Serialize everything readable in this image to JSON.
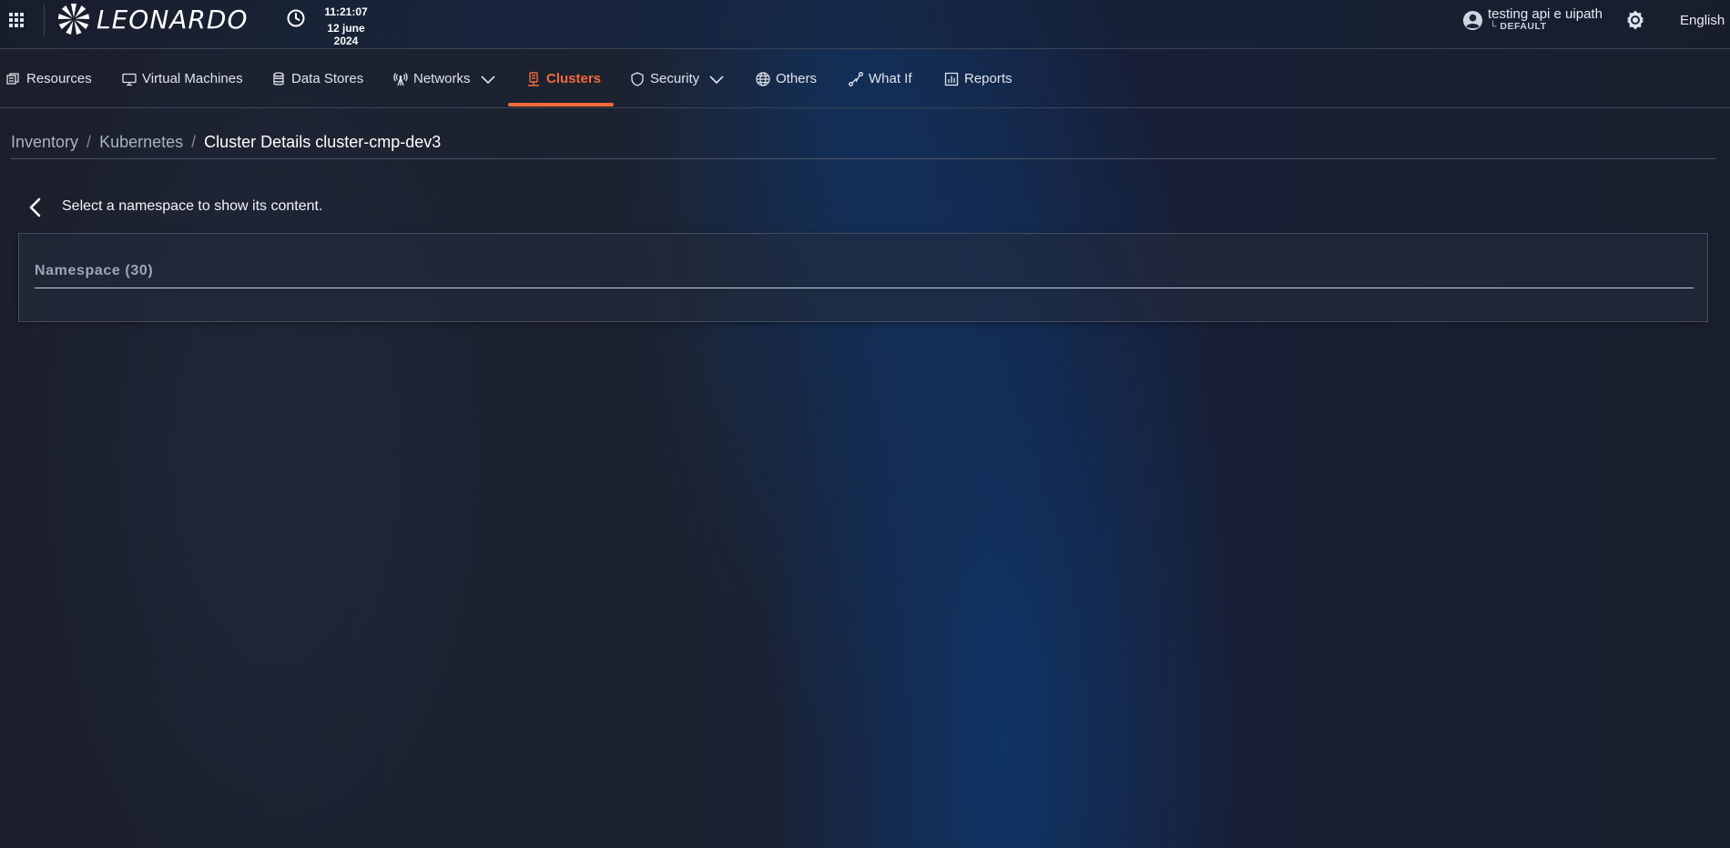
{
  "header": {
    "apps_icon": "grid-apps-icon",
    "brand": "LEONARDO",
    "clock": {
      "icon": "clock-icon",
      "time": "11:21:07",
      "date": "12 june 2024"
    },
    "user": {
      "icon": "account-circle-icon",
      "name": "testing api e uipath",
      "tenant": "└ DEFAULT"
    },
    "theme_icon": "brightness-icon",
    "language": "English"
  },
  "nav": {
    "accent_color": "#f26a3a",
    "items": [
      {
        "label": "Resources",
        "icon": "resources-icon"
      },
      {
        "label": "Virtual Machines",
        "icon": "monitor-icon"
      },
      {
        "label": "Data Stores",
        "icon": "database-icon"
      },
      {
        "label": "Networks",
        "icon": "antenna-icon",
        "has_dropdown": true
      },
      {
        "label": "Clusters",
        "icon": "cluster-icon",
        "active": true
      },
      {
        "label": "Security",
        "icon": "shield-icon",
        "has_dropdown": true
      },
      {
        "label": "Others",
        "icon": "globe-icon"
      },
      {
        "label": "What If",
        "icon": "path-icon"
      },
      {
        "label": "Reports",
        "icon": "report-icon"
      }
    ]
  },
  "breadcrumb": {
    "items": [
      "Inventory",
      "Kubernetes"
    ],
    "separator": "/",
    "current": "Cluster Details cluster-cmp-dev3"
  },
  "content": {
    "back_icon": "chevron-left-icon",
    "hint": "Select a namespace to show its content.",
    "namespace_select": {
      "label": "Namespace (30)"
    }
  }
}
